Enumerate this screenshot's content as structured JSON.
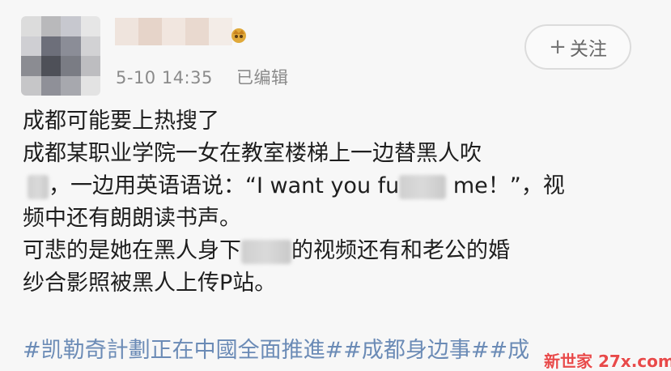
{
  "post": {
    "timestamp": "5-10 14:35",
    "edited_label": "已编辑",
    "follow_label": "关注",
    "follow_plus": "+",
    "lines": [
      {
        "parts": [
          "成都可能要上热搜了"
        ]
      },
      {
        "parts": [
          "成都某职业学院一女在教室楼梯上一边替黑人吹"
        ]
      },
      {
        "pre": "",
        "post": "，一边用英语语说：“I want you fu",
        "post2": " me！”，视"
      },
      {
        "parts": [
          "频中还有朗朗读书声。"
        ]
      },
      {
        "pre": "可悲的是她在黑人身下",
        "post": "的视频还有和老公的婚"
      },
      {
        "parts": [
          "纱合影照被黑人上传P站。"
        ]
      }
    ],
    "hashtags": "#凯勒奇計劃正在中國全面推進##成都身边事##成",
    "watermark": "新世家 27x.com"
  },
  "colors": {
    "background": "#f7f7f7",
    "meta_text": "#8a8a8a",
    "hashtag": "#6b8bb6",
    "watermark": "#e84a4a"
  },
  "icons": {
    "vip_badge": "vip-crown-badge-icon",
    "avatar": "pixelated-avatar"
  }
}
